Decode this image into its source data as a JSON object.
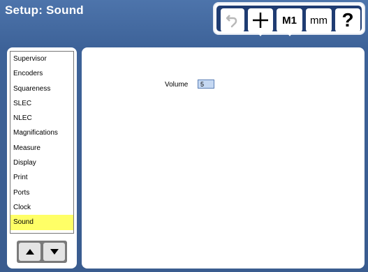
{
  "window": {
    "title": "Setup: Sound"
  },
  "toolbar": {
    "undo_icon": "undo-arrow-icon",
    "plus_icon": "plus-icon",
    "m1_label": "M1",
    "mm_label": "mm",
    "help_label": "?"
  },
  "menu": {
    "items": [
      {
        "label": "Supervisor"
      },
      {
        "label": "Encoders"
      },
      {
        "label": "Squareness"
      },
      {
        "label": "SLEC"
      },
      {
        "label": "NLEC"
      },
      {
        "label": "Magnifications"
      },
      {
        "label": "Measure"
      },
      {
        "label": "Display"
      },
      {
        "label": "Print"
      },
      {
        "label": "Ports"
      },
      {
        "label": "Clock"
      },
      {
        "label": "Sound"
      }
    ],
    "selected": "Sound",
    "selected_color": "#ffff66"
  },
  "nav": {
    "up_icon": "triangle-up-icon",
    "down_icon": "triangle-down-icon"
  },
  "sound": {
    "volume_label": "Volume",
    "volume_value": "5"
  }
}
